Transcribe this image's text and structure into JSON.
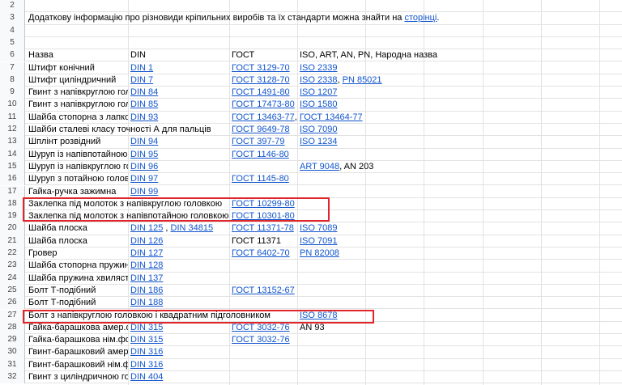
{
  "row_numbers": [
    "2",
    "3",
    "4",
    "5",
    "6",
    "7",
    "8",
    "9",
    "10",
    "11",
    "12",
    "13",
    "14",
    "15",
    "16",
    "17",
    "18",
    "19",
    "20",
    "21",
    "22",
    "23",
    "24",
    "25",
    "26",
    "27",
    "28",
    "29",
    "30",
    "31",
    "32"
  ],
  "intro": {
    "text": "Додаткову інформацію про різновиди кріпильних виробів та їх стандарти можна знайти на ",
    "link": "сторінці",
    "end": "."
  },
  "headers": {
    "name": "Назва",
    "din": "DIN",
    "gost": "ГОСТ",
    "iso": "ISO, ART, AN, PN, Народна назва"
  },
  "rows": [
    {
      "num": "7",
      "name": "Штифт конічний",
      "din": [
        {
          "t": "DIN 1",
          "l": true
        }
      ],
      "gost": [
        {
          "t": "ГОСТ 3129-70",
          "l": true
        }
      ],
      "iso": [
        {
          "t": "ISO 2339",
          "l": true
        }
      ]
    },
    {
      "num": "8",
      "name": "Штифт циліндричний",
      "din": [
        {
          "t": "DIN 7",
          "l": true
        }
      ],
      "gost": [
        {
          "t": "ГОСТ 3128-70",
          "l": true
        }
      ],
      "iso": [
        {
          "t": "ISO 2338",
          "l": true
        },
        {
          "t": ", ",
          "l": false
        },
        {
          "t": "PN 85021",
          "l": true
        }
      ]
    },
    {
      "num": "9",
      "name": "Гвинт з напівкруглою головкою",
      "din": [
        {
          "t": "DIN 84",
          "l": true
        }
      ],
      "gost": [
        {
          "t": "ГОСТ 1491-80",
          "l": true
        }
      ],
      "iso": [
        {
          "t": "ISO 1207",
          "l": true
        }
      ]
    },
    {
      "num": "10",
      "name": "Гвинт з напівкруглою головкою",
      "din": [
        {
          "t": "DIN 85",
          "l": true
        }
      ],
      "gost": [
        {
          "t": "ГОСТ 17473-80",
          "l": true
        }
      ],
      "iso": [
        {
          "t": "ISO 1580",
          "l": true
        }
      ]
    },
    {
      "num": "11",
      "name": "Шайба стопорна з лапкою",
      "din": [
        {
          "t": "DIN 93",
          "l": true
        }
      ],
      "gost": [
        {
          "t": "ГОСТ 13463-77",
          "l": true
        },
        {
          "t": ", ",
          "l": false
        },
        {
          "t": "ГОСТ 13464-77",
          "l": true
        }
      ],
      "iso": []
    },
    {
      "num": "12",
      "name": "Шайби сталеві класу точності А для пальців",
      "overflow": true,
      "din": [],
      "gost": [
        {
          "t": "ГОСТ 9649-78",
          "l": true
        }
      ],
      "iso": [
        {
          "t": "ISO 7090",
          "l": true
        }
      ]
    },
    {
      "num": "13",
      "name": "Шплінт розвідний",
      "din": [
        {
          "t": "DIN 94",
          "l": true
        }
      ],
      "gost": [
        {
          "t": "ГОСТ 397-79",
          "l": true
        }
      ],
      "iso": [
        {
          "t": "ISO 1234",
          "l": true
        }
      ]
    },
    {
      "num": "14",
      "name": "Шуруп із напівпотайною головкою",
      "din": [
        {
          "t": "DIN 95",
          "l": true
        }
      ],
      "gost": [
        {
          "t": "ГОСТ 1146-80",
          "l": true
        }
      ],
      "iso": []
    },
    {
      "num": "15",
      "name": "Шуруп із напівкруглою головкою",
      "din": [
        {
          "t": "DIN 96",
          "l": true
        }
      ],
      "gost": [],
      "iso": [
        {
          "t": "ART 9048",
          "l": true
        },
        {
          "t": ", AN 203",
          "l": false
        }
      ]
    },
    {
      "num": "16",
      "name": "Шуруп з потайною головкою",
      "din": [
        {
          "t": "DIN 97",
          "l": true
        }
      ],
      "gost": [
        {
          "t": "ГОСТ 1145-80",
          "l": true
        }
      ],
      "iso": []
    },
    {
      "num": "17",
      "name": "Гайка-ручка зажимна",
      "din": [
        {
          "t": "DIN 99",
          "l": true
        }
      ],
      "gost": [],
      "iso": []
    },
    {
      "num": "18",
      "name": "Заклепка під молоток з напівкруглою головкою",
      "overflow": true,
      "din": [],
      "gost": [
        {
          "t": "ГОСТ 10299-80",
          "l": true
        }
      ],
      "iso": []
    },
    {
      "num": "19",
      "name": "Заклепка під молоток з напівпотайною головкою",
      "overflow": true,
      "din": [],
      "gost": [
        {
          "t": "ГОСТ 10301-80",
          "l": true
        }
      ],
      "iso": []
    },
    {
      "num": "20",
      "name": "Шайба плоска",
      "din": [
        {
          "t": "DIN 125",
          "l": true
        },
        {
          "t": " , ",
          "l": false
        },
        {
          "t": "DIN 34815",
          "l": true
        }
      ],
      "gost": [
        {
          "t": "ГОСТ 11371-78",
          "l": true
        }
      ],
      "iso": [
        {
          "t": "ISO 7089",
          "l": true
        }
      ]
    },
    {
      "num": "21",
      "name": "Шайба плоска",
      "din": [
        {
          "t": "DIN 126",
          "l": true
        }
      ],
      "gost": [
        {
          "t": "ГОСТ 11371",
          "l": false
        }
      ],
      "iso": [
        {
          "t": "ISO 7091",
          "l": true
        }
      ]
    },
    {
      "num": "22",
      "name": "Гровер",
      "din": [
        {
          "t": "DIN 127",
          "l": true
        }
      ],
      "gost": [
        {
          "t": "ГОСТ 6402-70",
          "l": true
        }
      ],
      "iso": [
        {
          "t": "PN 82008",
          "l": true
        }
      ]
    },
    {
      "num": "23",
      "name": "Шайба стопорна пружинна",
      "din": [
        {
          "t": "DIN 128",
          "l": true
        }
      ],
      "gost": [],
      "iso": []
    },
    {
      "num": "24",
      "name": "Шайба пружина хвиляста",
      "din": [
        {
          "t": "DIN 137",
          "l": true
        }
      ],
      "gost": [],
      "iso": []
    },
    {
      "num": "25",
      "name": "Болт Т-подібний",
      "din": [
        {
          "t": "DIN 186",
          "l": true
        }
      ],
      "gost": [
        {
          "t": "ГОСТ 13152-67",
          "l": true
        }
      ],
      "iso": []
    },
    {
      "num": "26",
      "name": "Болт Т-подібний",
      "din": [
        {
          "t": "DIN 188",
          "l": true
        }
      ],
      "gost": [],
      "iso": []
    },
    {
      "num": "27",
      "name": "Болт з напівкруглою головкою і квадратним підголовником",
      "overflow": true,
      "din": [],
      "gost": [],
      "iso": [
        {
          "t": "ISO 8678",
          "l": true
        }
      ]
    },
    {
      "num": "28",
      "name": "Гайка-барашкова амер.форма",
      "din": [
        {
          "t": "DIN 315",
          "l": true
        }
      ],
      "gost": [
        {
          "t": "ГОСТ 3032-76",
          "l": true
        }
      ],
      "iso": [
        {
          "t": "AN 93",
          "l": false
        }
      ]
    },
    {
      "num": "29",
      "name": "Гайка-барашкова нім.форма",
      "din": [
        {
          "t": "DIN 315",
          "l": true
        }
      ],
      "gost": [
        {
          "t": "ГОСТ 3032-76",
          "l": true
        }
      ],
      "iso": []
    },
    {
      "num": "30",
      "name": "Гвинт-барашковий амер.форма",
      "din": [
        {
          "t": "DIN 316",
          "l": true
        }
      ],
      "gost": [],
      "iso": []
    },
    {
      "num": "31",
      "name": "Гвинт-барашковий нім.форма",
      "din": [
        {
          "t": "DIN 316",
          "l": true
        }
      ],
      "gost": [],
      "iso": []
    },
    {
      "num": "32",
      "name": "Гвинт з циліндричною головкою",
      "din": [
        {
          "t": "DIN 404",
          "l": true
        }
      ],
      "gost": [],
      "iso": []
    }
  ],
  "colors": {
    "link": "#1155cc",
    "highlight": "#e0262b",
    "grid": "#e2e2e2"
  }
}
